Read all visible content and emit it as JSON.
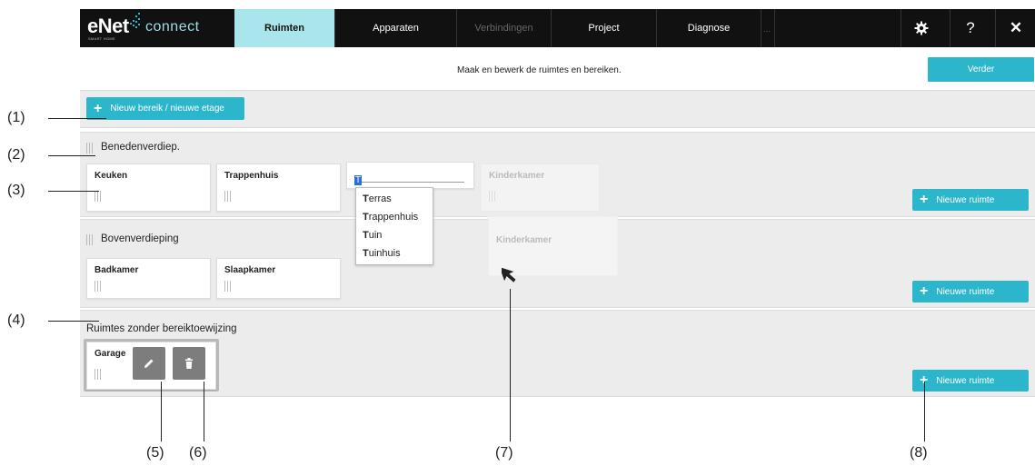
{
  "app": {
    "brand_e": "eNet",
    "brand_connect": "connect",
    "brand_sub": "SMART HOME"
  },
  "tabs": [
    {
      "label": "Ruimten",
      "state": "active"
    },
    {
      "label": "Apparaten",
      "state": "normal"
    },
    {
      "label": "Verbindingen",
      "state": "disabled"
    },
    {
      "label": "Project",
      "state": "normal"
    },
    {
      "label": "Diagnose",
      "state": "normal"
    },
    {
      "label": "...",
      "state": "more"
    }
  ],
  "toolbar": {
    "settings_icon": "gear-icon",
    "help_label": "?",
    "close_label": "✕"
  },
  "info": {
    "text": "Maak en bewerk de ruimtes en bereiken.",
    "next_label": "Verder"
  },
  "new_area_button": "Nieuw bereik / nieuwe etage",
  "groups": [
    {
      "title": "Benedenverdiep.",
      "rooms": [
        "Keuken",
        "Trappenhuis"
      ],
      "ghost_room": "Kinderkamer",
      "new_room_label": "Nieuwe ruimte"
    },
    {
      "title": "Bovenverdieping",
      "rooms": [
        "Badkamer",
        "Slaapkamer"
      ],
      "new_room_label": "Nieuwe ruimte"
    },
    {
      "title": "Ruimtes zonder bereiktoewijzing",
      "rooms": [
        "Garage"
      ],
      "new_room_label": "Nieuwe ruimte"
    }
  ],
  "edit_input": {
    "value": "T"
  },
  "suggestions": [
    {
      "bold": "T",
      "rest": "erras"
    },
    {
      "bold": "T",
      "rest": "rappenhuis"
    },
    {
      "bold": "T",
      "rest": "uin"
    },
    {
      "bold": "T",
      "rest": "uinhuis"
    }
  ],
  "dragging_card": "Kinderkamer",
  "callouts": [
    "(1)",
    "(2)",
    "(3)",
    "(4)",
    "(5)",
    "(6)",
    "(7)",
    "(8)"
  ],
  "colors": {
    "accent": "#2cb6cc",
    "active_tab": "#a8e6ec",
    "topbar": "#111111",
    "panel": "#ececec"
  }
}
